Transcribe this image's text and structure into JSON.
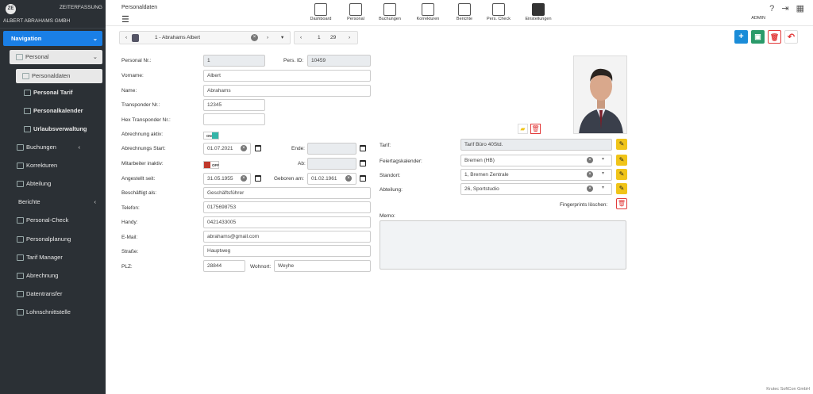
{
  "sidebar": {
    "logo_text": "ZE",
    "app_name": "ZEITERFASSUNG",
    "company": "ALBERT ABRAHAMS GMBH",
    "navigation_label": "Navigation",
    "personal_label": "Personal",
    "items": [
      {
        "label": "Personaldaten"
      },
      {
        "label": "Personal Tarif"
      },
      {
        "label": "Personalkalender"
      },
      {
        "label": "Urlaubsverwaltung"
      },
      {
        "label": "Buchungen"
      },
      {
        "label": "Korrekturen"
      },
      {
        "label": "Abteilung"
      },
      {
        "label": "Berichte"
      },
      {
        "label": "Personal-Check"
      },
      {
        "label": "Personalplanung"
      },
      {
        "label": "Tarif Manager"
      },
      {
        "label": "Abrechnung"
      },
      {
        "label": "Datentransfer"
      },
      {
        "label": "Lohnschnittstelle"
      }
    ]
  },
  "header": {
    "title": "Personaldaten",
    "tools": [
      {
        "label": "Dashboard",
        "icon": "dashboard-icon"
      },
      {
        "label": "Personal",
        "icon": "people-icon"
      },
      {
        "label": "Buchungen",
        "icon": "bookings-icon"
      },
      {
        "label": "Korrekturen",
        "icon": "corrections-icon"
      },
      {
        "label": "Berichte",
        "icon": "printer-icon"
      },
      {
        "label": "Pers. Check",
        "icon": "org-chart-icon"
      },
      {
        "label": "Einstellungen",
        "icon": "settings-icon"
      }
    ],
    "user": "ADMIN",
    "top_icons": "? ⇥ ▦"
  },
  "record": {
    "selected": "1 - Abrahams  Albert",
    "page": "1",
    "total": "29"
  },
  "form": {
    "personal_nr_label": "Personal Nr.:",
    "personal_nr": "1",
    "pers_id_label": "Pers. ID:",
    "pers_id": "10459",
    "vorname_label": "Vorname:",
    "vorname": "Albert",
    "name_label": "Name:",
    "name": "Abrahams",
    "transponder_label": "Transponder Nr.:",
    "transponder": "12345",
    "hex_transponder_label": "Hex Transponder Nr.:",
    "hex_transponder": "",
    "abrechnung_aktiv_label": "Abrechnung aktiv:",
    "abrechnung_aktiv": "ON",
    "abrechnungs_start_label": "Abrechnungs Start:",
    "abrechnungs_start": "01.07.2021",
    "ende_label": "Ende:",
    "ende": "",
    "mitarbeiter_inaktiv_label": "Mitarbeiter inaktiv:",
    "mitarbeiter_inaktiv": "OFF",
    "ab_label": "Ab:",
    "ab": "",
    "angestellt_label": "Angestellt seit:",
    "angestellt": "31.05.1955",
    "geboren_label": "Geboren am:",
    "geboren": "01.02.1961",
    "beschaeftigt_label": "Beschäftigt als:",
    "beschaeftigt": "Geschäftsführer",
    "telefon_label": "Telefon:",
    "telefon": "0175698753",
    "handy_label": "Handy:",
    "handy": "0421433005",
    "email_label": "E-Mail:",
    "email": "abrahams@gmail.com",
    "strasse_label": "Straße:",
    "strasse": "Hauptweg",
    "plz_label": "PLZ:",
    "plz": "28844",
    "wohnort_label": "Wohnort:",
    "wohnort": "Weyhe",
    "tarif_label": "Tarif:",
    "tarif": "Tarif Büro 40Std.",
    "feiertag_label": "Feiertagskalender:",
    "feiertag": "Bremen (HB)",
    "standort_label": "Standort:",
    "standort": "1, Bremen Zentrale",
    "abteilung_label": "Abteilung:",
    "abteilung": "26, Sportstudio",
    "fingerprints_label": "Fingerprints löschen:",
    "memo_label": "Memo:",
    "memo": ""
  },
  "footer": "Krutec SoftCon GmbH",
  "colors": {
    "sidebar": "#2b3035",
    "accent": "#1a7fe6",
    "add": "#1a8cd8",
    "save": "#2a9a6a",
    "delete": "#e23b3b",
    "edit": "#f0c419",
    "on": "#34b5a8",
    "off": "#c0392b"
  }
}
